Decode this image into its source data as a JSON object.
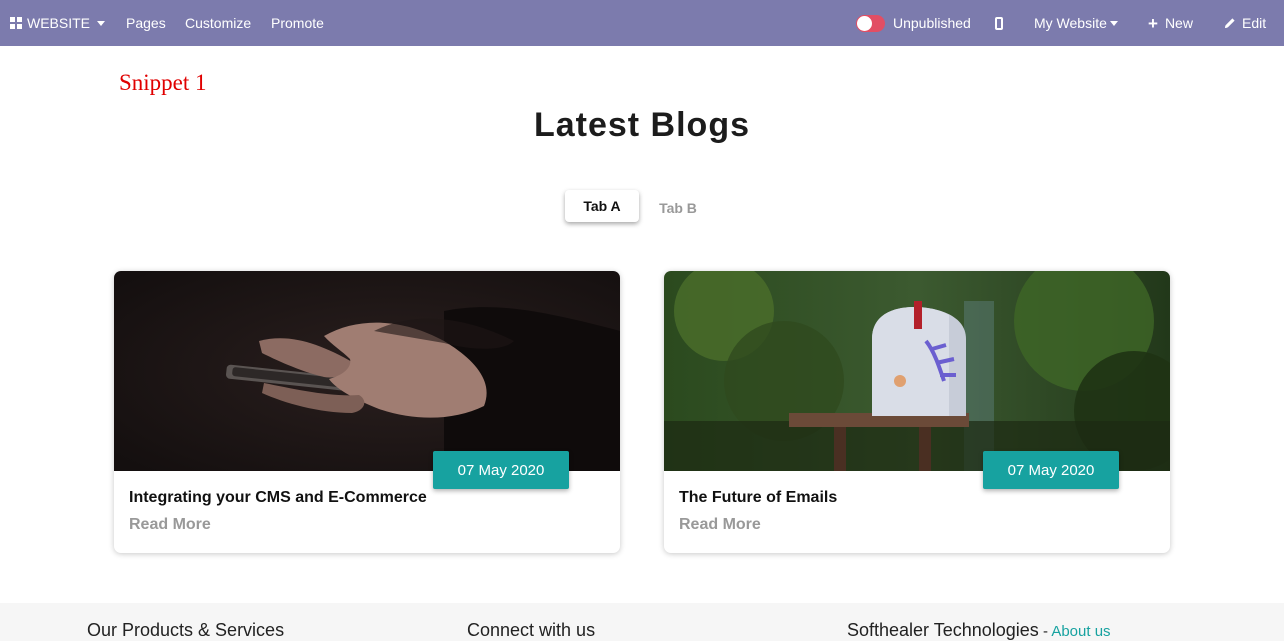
{
  "navbar": {
    "website_label": "WEBSITE",
    "pages": "Pages",
    "customize": "Customize",
    "promote": "Promote",
    "publish_status": "Unpublished",
    "my_website": "My Website",
    "new": "New",
    "edit": "Edit",
    "bar_color": "#7c7bad",
    "toggle_color": "#e24e64"
  },
  "snippet_label": "Snippet 1",
  "page_title": "Latest Blogs",
  "tabs": [
    {
      "label": "Tab A",
      "active": true
    },
    {
      "label": "Tab B",
      "active": false
    }
  ],
  "posts": [
    {
      "date": "07 May 2020",
      "title": "Integrating your CMS and E-Commerce",
      "read_more": "Read More",
      "image": "hands-holding-smartphone"
    },
    {
      "date": "07 May 2020",
      "title": "The Future of Emails",
      "read_more": "Read More",
      "image": "mailbox-in-garden"
    }
  ],
  "accent_color": "#17a2a0",
  "footer": {
    "col1": "Our Products & Services",
    "col2": "Connect with us",
    "col3": "Softhealer Technologies",
    "col3_sep": " - ",
    "col3_link": "About us"
  }
}
